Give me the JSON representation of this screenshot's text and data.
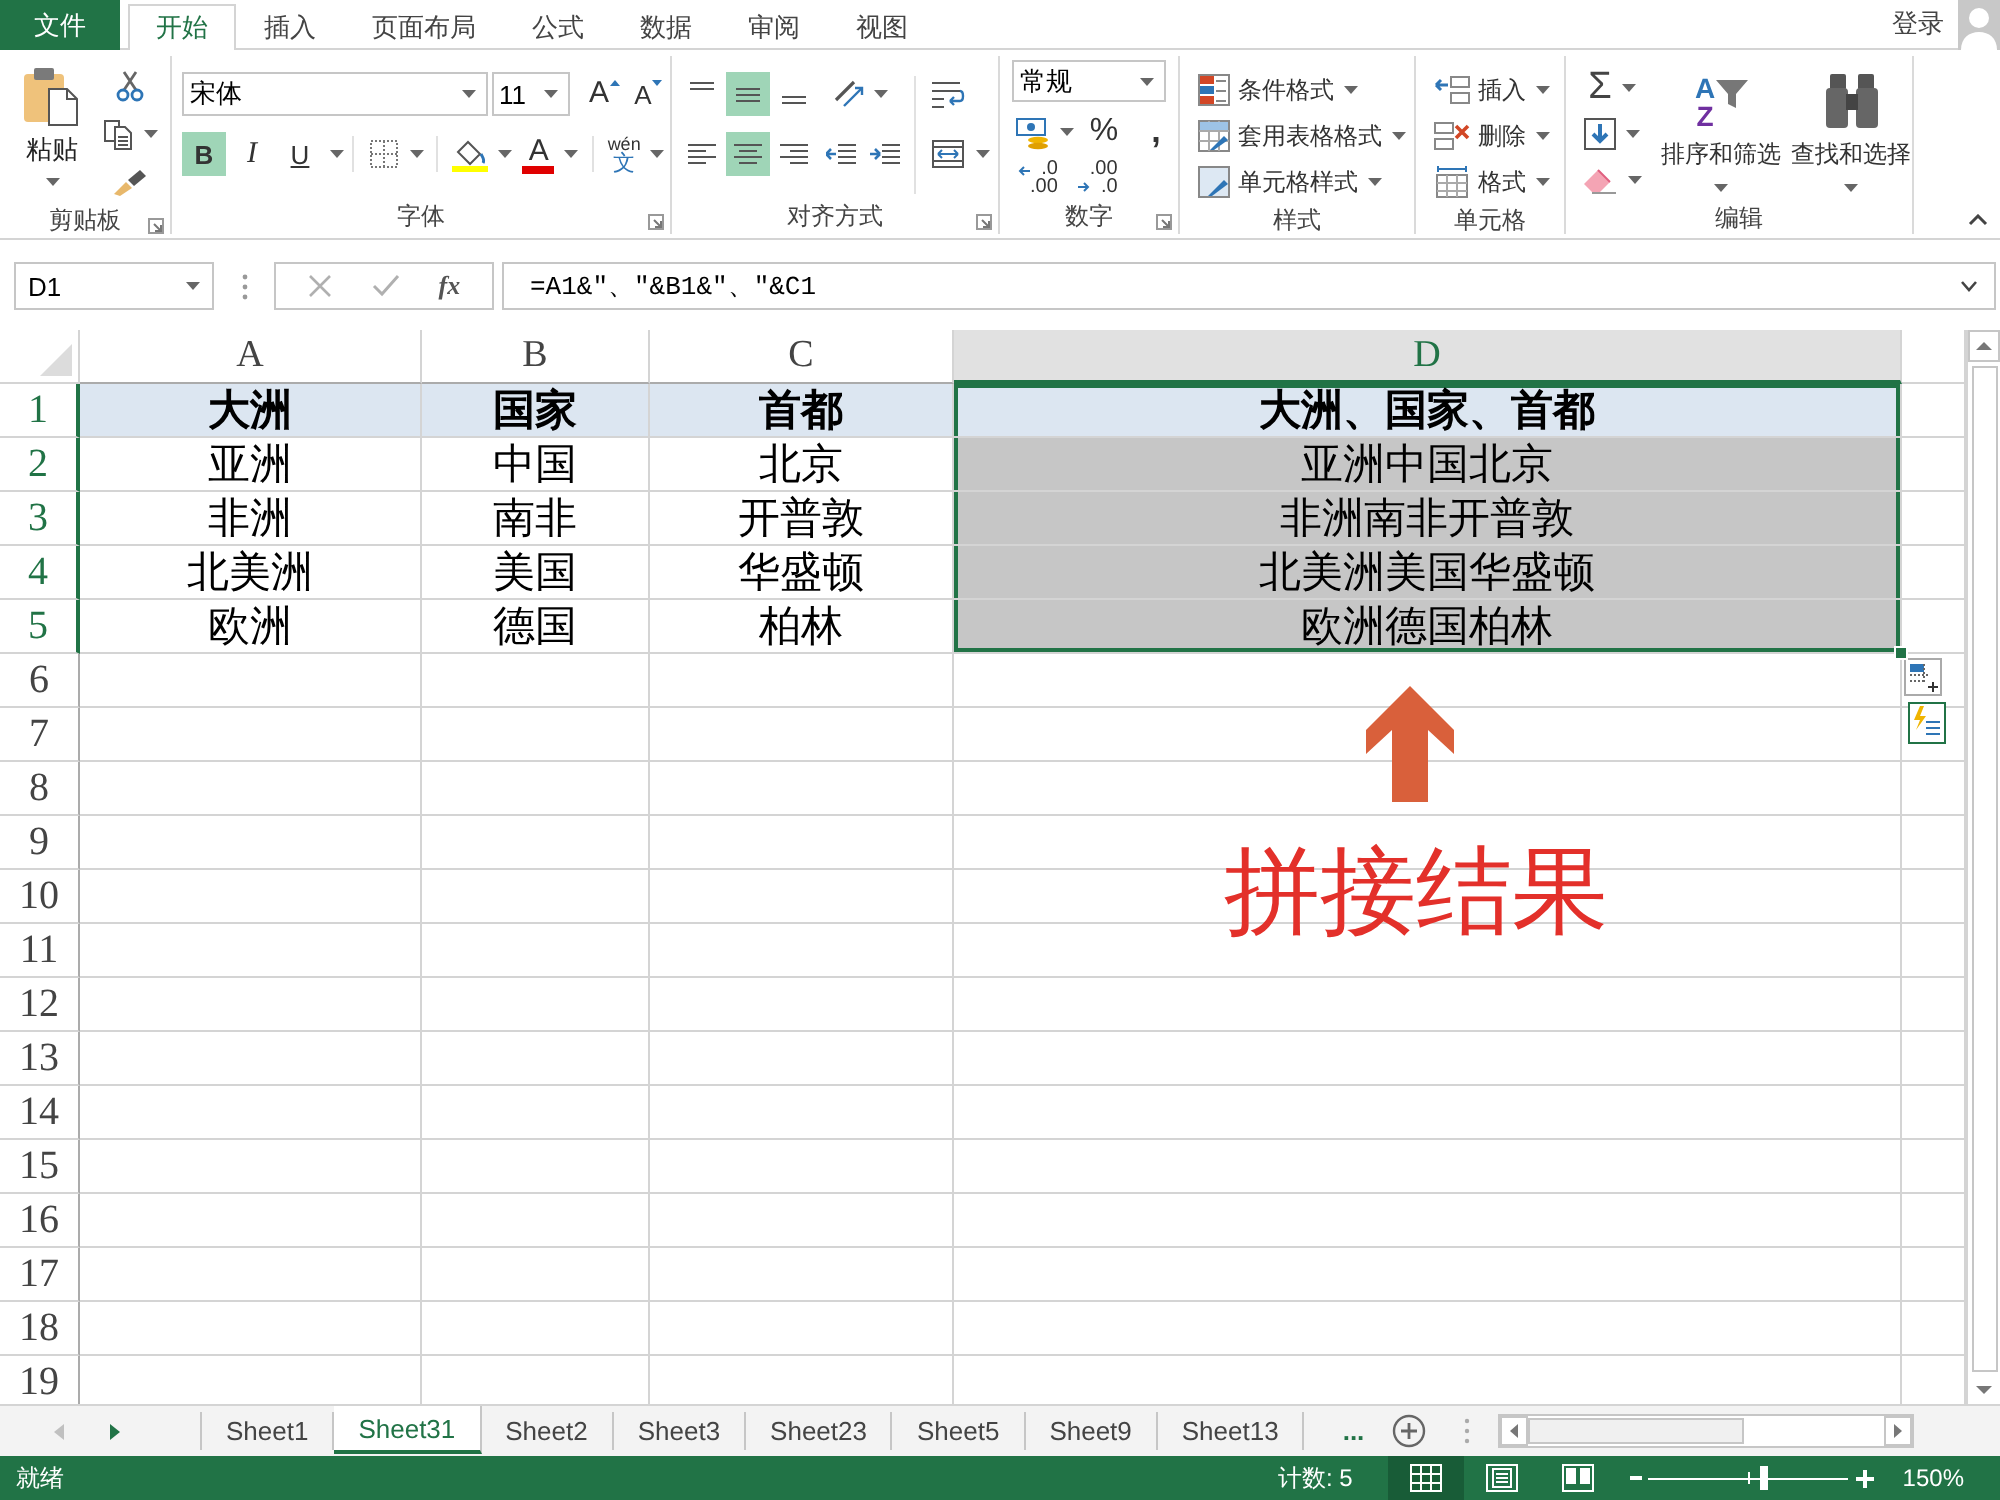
{
  "title_bar": {
    "file_tab": "文件",
    "tabs": [
      {
        "label": "开始",
        "selected": true
      },
      {
        "label": "插入",
        "selected": false
      },
      {
        "label": "页面布局",
        "selected": false
      },
      {
        "label": "公式",
        "selected": false
      },
      {
        "label": "数据",
        "selected": false
      },
      {
        "label": "审阅",
        "selected": false
      },
      {
        "label": "视图",
        "selected": false
      }
    ],
    "sign_in": "登录"
  },
  "ribbon": {
    "clipboard": {
      "label": "剪贴板",
      "paste": "粘贴"
    },
    "font": {
      "label": "字体",
      "font_name": "宋体",
      "font_size": "11",
      "grow": "A",
      "shrink": "A",
      "styles": [
        {
          "kind": "bold",
          "label": "B",
          "selected": true
        },
        {
          "kind": "italic",
          "label": "I",
          "selected": false
        },
        {
          "kind": "underline",
          "label": "U",
          "selected": false
        }
      ],
      "font_color": "A",
      "phonetic": {
        "pinyin": "wén",
        "character": "文"
      }
    },
    "alignment": {
      "label": "对齐方式",
      "vertical": [
        {
          "kind": "top",
          "selected": false
        },
        {
          "kind": "middle",
          "selected": true
        },
        {
          "kind": "bottom",
          "selected": false
        }
      ],
      "horizontal": [
        {
          "kind": "left",
          "selected": false
        },
        {
          "kind": "center",
          "selected": true
        },
        {
          "kind": "right",
          "selected": false
        }
      ]
    },
    "number": {
      "label": "数字",
      "format": "常规",
      "percent": "%",
      "comma": ",",
      "decimals": [
        {
          "kind": "increase",
          "top": ".0",
          "bottom": ".00"
        },
        {
          "kind": "decrease",
          "top": ".00",
          "bottom": ".0"
        }
      ]
    },
    "styles": {
      "label": "样式",
      "items": [
        {
          "kind": "conditional",
          "label": "条件格式"
        },
        {
          "kind": "table",
          "label": "套用表格格式"
        },
        {
          "kind": "cell",
          "label": "单元格样式"
        }
      ]
    },
    "cells": {
      "label": "单元格",
      "items": [
        {
          "kind": "insert",
          "label": "插入"
        },
        {
          "kind": "delete",
          "label": "删除"
        },
        {
          "kind": "format",
          "label": "格式"
        }
      ]
    },
    "editing": {
      "label": "编辑",
      "sum": "Σ",
      "sort_letters": [
        "A",
        "Z"
      ],
      "sort": "排序和筛选",
      "find": "查找和选择"
    }
  },
  "formula_bar": {
    "name_box": "D1",
    "fx": "fx",
    "formula": "=A1&\"、\"&B1&\"、\"&C1"
  },
  "sheet": {
    "columns": [
      {
        "label": "A",
        "selected": false
      },
      {
        "label": "B",
        "selected": false
      },
      {
        "label": "C",
        "selected": false
      },
      {
        "label": "D",
        "selected": true
      }
    ],
    "rows": [
      {
        "label": "1",
        "selected": true,
        "kind": "header",
        "cells": [
          "大洲",
          "国家",
          "首都",
          "大洲、国家、首都"
        ]
      },
      {
        "label": "2",
        "selected": true,
        "kind": "data",
        "cells": [
          "亚洲",
          "中国",
          "北京",
          "亚洲中国北京"
        ]
      },
      {
        "label": "3",
        "selected": true,
        "kind": "data",
        "cells": [
          "非洲",
          "南非",
          "开普敦",
          "非洲南非开普敦"
        ]
      },
      {
        "label": "4",
        "selected": true,
        "kind": "data",
        "cells": [
          "北美洲",
          "美国",
          "华盛顿",
          "北美洲美国华盛顿"
        ]
      },
      {
        "label": "5",
        "selected": true,
        "kind": "data",
        "cells": [
          "欧洲",
          "德国",
          "柏林",
          "欧洲德国柏林"
        ]
      },
      {
        "label": "6",
        "selected": false,
        "kind": "empty"
      },
      {
        "label": "7",
        "selected": false,
        "kind": "empty"
      },
      {
        "label": "8",
        "selected": false,
        "kind": "empty"
      },
      {
        "label": "9",
        "selected": false,
        "kind": "empty"
      },
      {
        "label": "10",
        "selected": false,
        "kind": "empty"
      },
      {
        "label": "11",
        "selected": false,
        "kind": "empty"
      },
      {
        "label": "12",
        "selected": false,
        "kind": "empty"
      },
      {
        "label": "13",
        "selected": false,
        "kind": "empty"
      },
      {
        "label": "14",
        "selected": false,
        "kind": "empty"
      },
      {
        "label": "15",
        "selected": false,
        "kind": "empty"
      },
      {
        "label": "16",
        "selected": false,
        "kind": "empty"
      },
      {
        "label": "17",
        "selected": false,
        "kind": "empty"
      },
      {
        "label": "18",
        "selected": false,
        "kind": "empty"
      },
      {
        "label": "19",
        "selected": false,
        "kind": "empty"
      }
    ]
  },
  "annotation": {
    "text": "拼接结果"
  },
  "sheet_tabs": {
    "scroll_buttons": [
      {
        "kind": "previous",
        "disabled": true
      },
      {
        "kind": "next",
        "disabled": false
      }
    ],
    "tabs": [
      {
        "label": "Sheet1",
        "selected": false
      },
      {
        "label": "Sheet31",
        "selected": true
      },
      {
        "label": "Sheet2",
        "selected": false
      },
      {
        "label": "Sheet3",
        "selected": false
      },
      {
        "label": "Sheet23",
        "selected": false
      },
      {
        "label": "Sheet5",
        "selected": false
      },
      {
        "label": "Sheet9",
        "selected": false
      },
      {
        "label": "Sheet13",
        "selected": false
      }
    ],
    "more": "..."
  },
  "status_bar": {
    "status": "就绪",
    "count": "计数: 5",
    "views": [
      {
        "kind": "normal",
        "selected": true
      },
      {
        "kind": "page_layout",
        "selected": false
      },
      {
        "kind": "page_break",
        "selected": false
      }
    ],
    "zoom": {
      "level": 0.58,
      "reading": "150%"
    }
  }
}
